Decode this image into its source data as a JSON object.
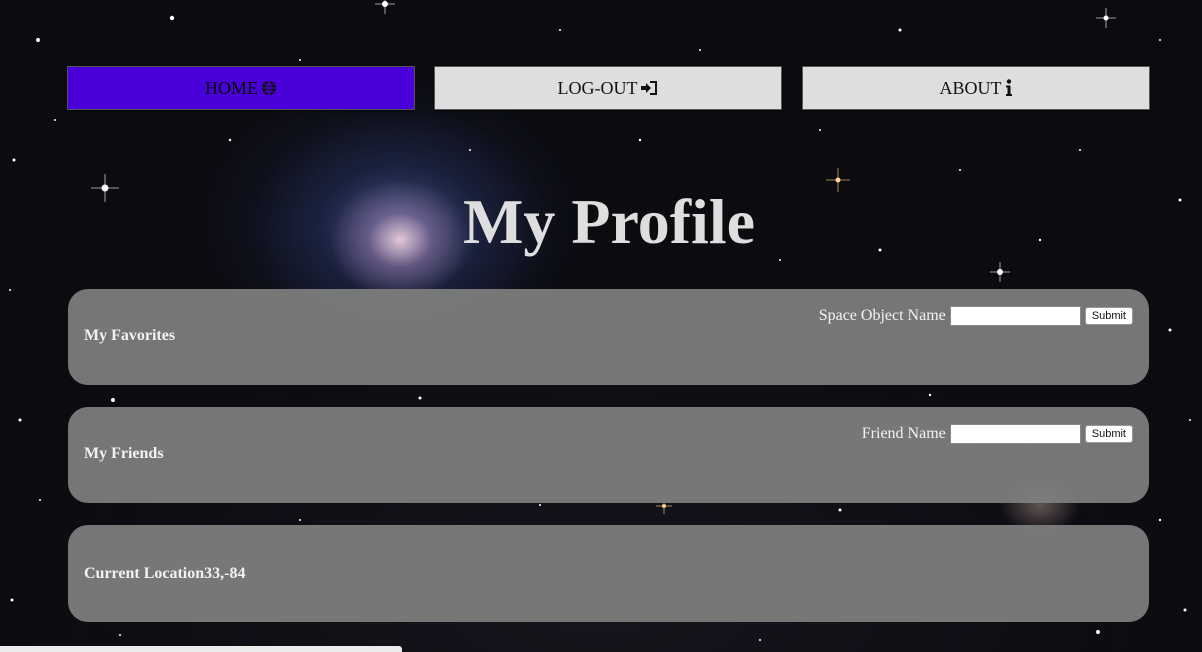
{
  "nav": {
    "home_label": "HOME",
    "logout_label": "LOG-OUT",
    "about_label": "ABOUT",
    "home_icon": "globe-icon",
    "logout_icon": "sign-in-icon",
    "about_icon": "info-icon"
  },
  "page": {
    "title": "My Profile"
  },
  "favorites": {
    "heading": "My Favorites",
    "input_label": "Space Object Name",
    "input_value": "",
    "submit_label": "Submit"
  },
  "friends": {
    "heading": "My Friends",
    "input_label": "Friend Name",
    "input_value": "",
    "submit_label": "Submit"
  },
  "location": {
    "heading": "Current Location33,-84"
  },
  "colors": {
    "home_active": "#4a00d9",
    "nav_inactive": "#dedede",
    "card_background": "#808080",
    "title_text": "#dedede"
  }
}
